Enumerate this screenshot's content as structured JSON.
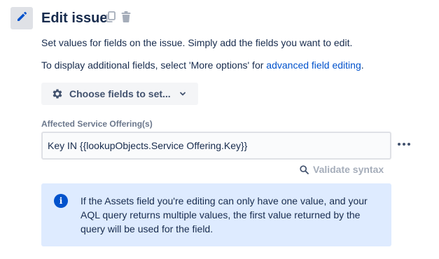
{
  "header": {
    "title": "Edit issue",
    "icons": [
      "pencil-icon",
      "copy-icon",
      "trash-icon"
    ]
  },
  "description": {
    "line1": "Set values for fields on the issue. Simply add the fields you want to edit.",
    "line2_prefix": "To display additional fields, select 'More options' for ",
    "line2_link": "advanced field editing",
    "line2_suffix": "."
  },
  "choose_fields": {
    "label": "Choose fields to set...",
    "icon": "gear-icon"
  },
  "field": {
    "label": "Affected Service Offering(s)",
    "value": "Key IN {{lookupObjects.Service Offering.Key}}"
  },
  "validate": {
    "label": "Validate syntax",
    "icon": "search-icon"
  },
  "info": {
    "text": "If the Assets field you're editing can only have one value, and your AQL query returns multiple values, the first value returned by the query will be used for the field."
  },
  "colors": {
    "link": "#0052cc",
    "info_bg": "#deebff",
    "info_icon": "#0052cc",
    "text": "#172b4d"
  }
}
